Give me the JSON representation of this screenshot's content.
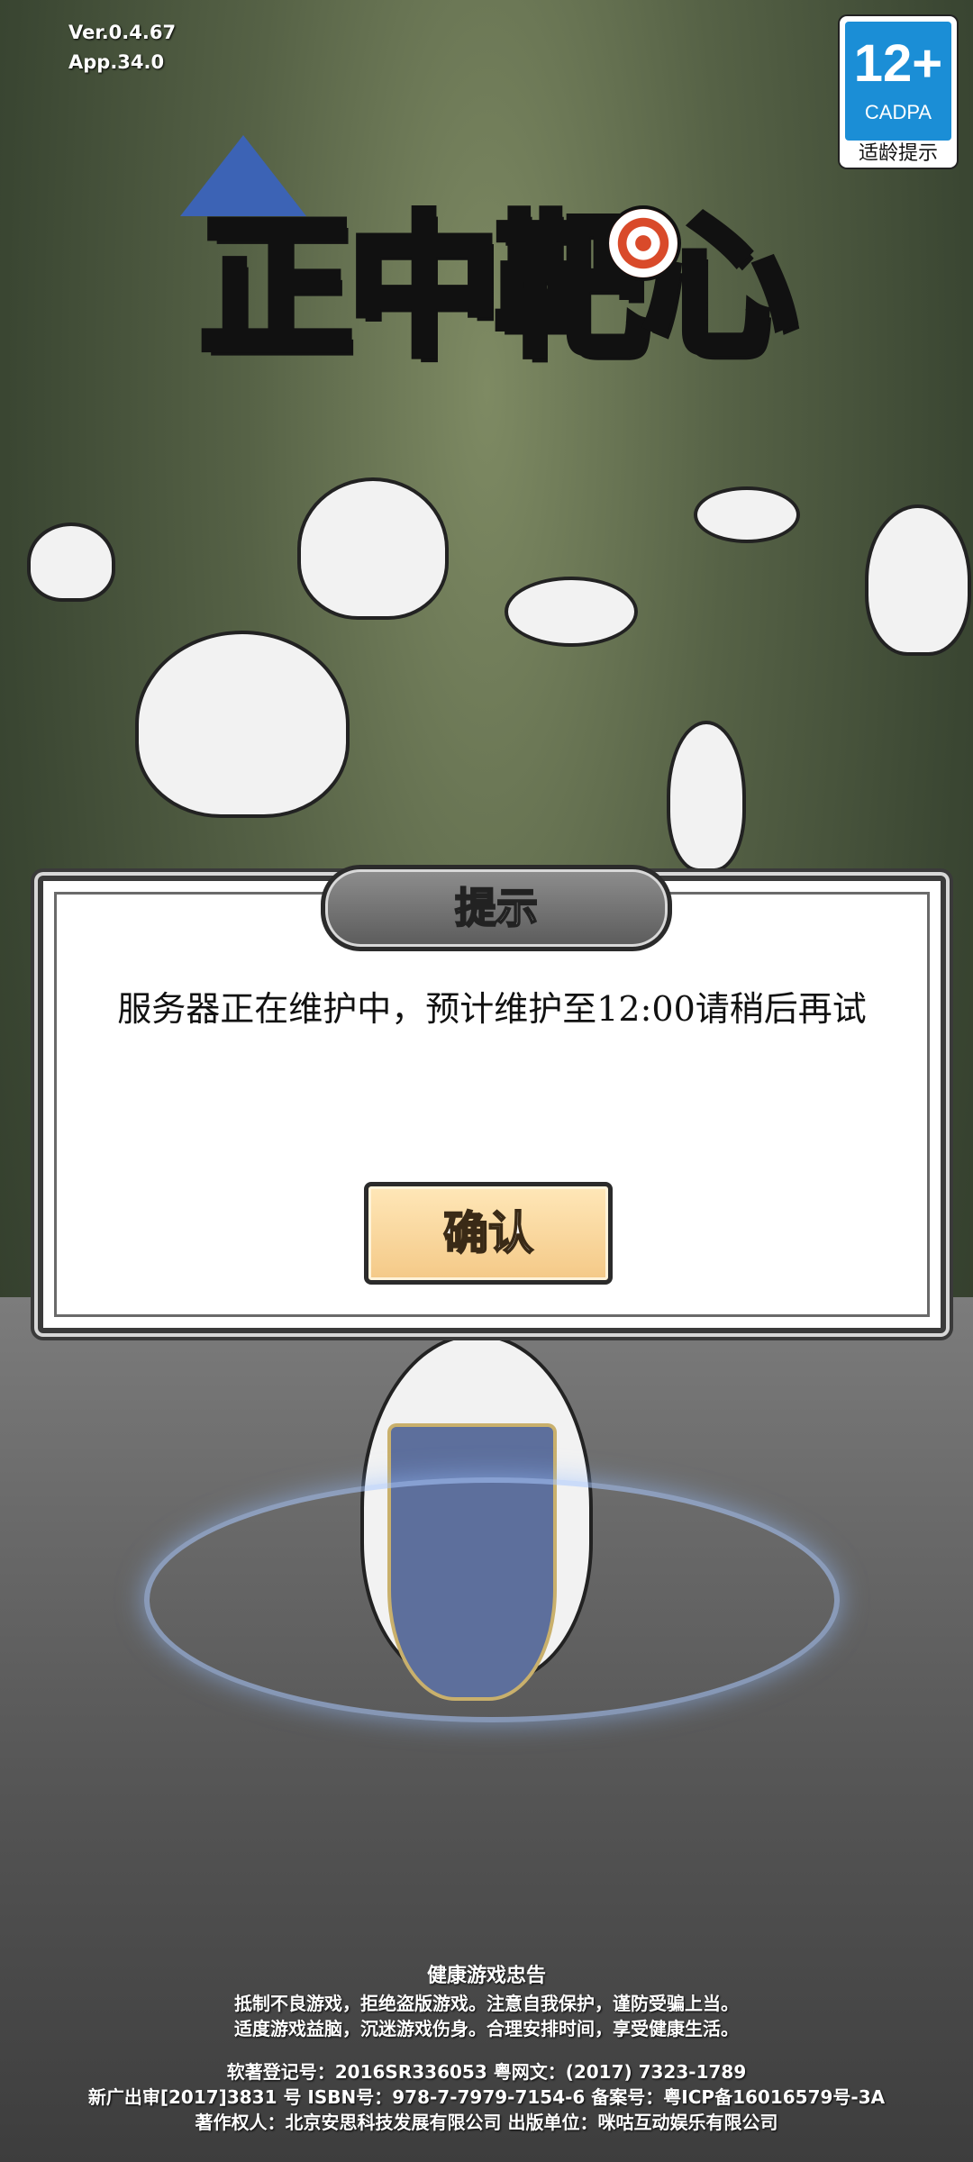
{
  "app": {
    "version": "Ver.0.4.67",
    "app_version": "App.34.0",
    "title": "正中靶心"
  },
  "age_rating": {
    "label": "12+",
    "org": "CADPA",
    "caption": "适龄提示",
    "color": "#1b8ed6"
  },
  "dialog": {
    "title": "提示",
    "message": "服务器正在维护中，预计维护至12:00请稍后再试",
    "confirm_label": "确认"
  },
  "footer": {
    "notice_title": "健康游戏忠告",
    "notice_lines": [
      "抵制不良游戏，拒绝盗版游戏。注意自我保护，谨防受骗上当。",
      "适度游戏益脑，沉迷游戏伤身。合理安排时间，享受健康生活。"
    ],
    "registration_lines": [
      "软著登记号：2016SR336053  粤网文：(2017) 7323-1789",
      "新广出审[2017]3831 号  ISBN号：978-7-7979-7154-6  备案号：粤ICP备16016579号-3A",
      "著作权人：北京安思科技发展有限公司  出版单位：咪咕互动娱乐有限公司"
    ]
  }
}
